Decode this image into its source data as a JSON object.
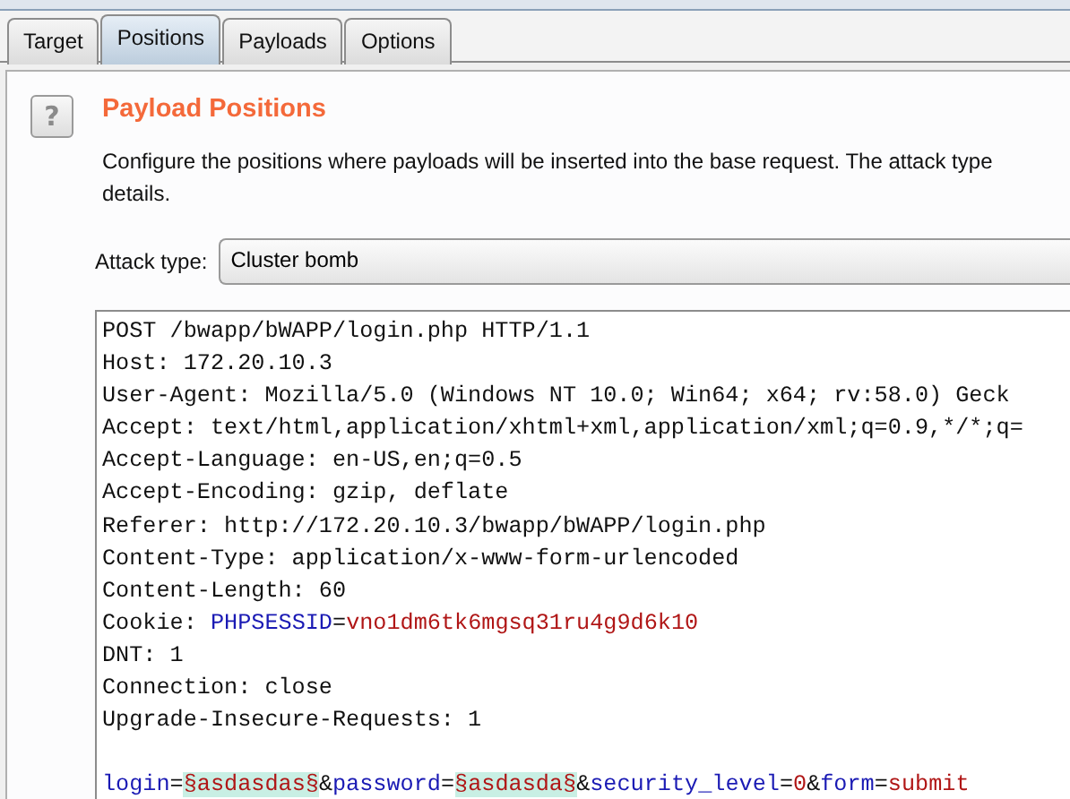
{
  "tabs": [
    {
      "label": "Target",
      "selected": false
    },
    {
      "label": "Positions",
      "selected": true
    },
    {
      "label": "Payloads",
      "selected": false
    },
    {
      "label": "Options",
      "selected": false
    }
  ],
  "help_button": {
    "label": "?"
  },
  "section": {
    "title": "Payload Positions",
    "description": [
      "Configure the positions where payloads will be inserted into the base request. The attack type",
      "details."
    ]
  },
  "attack_type": {
    "label": "Attack type:",
    "value": "Cluster bomb"
  },
  "request_editor": {
    "lines": [
      {
        "kind": "text",
        "segments": [
          {
            "kind": "plain",
            "text": "POST /bwapp/bWAPP/login.php HTTP/1.1"
          }
        ]
      },
      {
        "kind": "text",
        "segments": [
          {
            "kind": "plain",
            "text": "Host: 172.20.10.3"
          }
        ]
      },
      {
        "kind": "text",
        "segments": [
          {
            "kind": "plain",
            "text": "User-Agent: Mozilla/5.0 (Windows NT 10.0; Win64; x64; rv:58.0) Geck"
          }
        ]
      },
      {
        "kind": "text",
        "segments": [
          {
            "kind": "plain",
            "text": "Accept: text/html,application/xhtml+xml,application/xml;q=0.9,*/*;q="
          }
        ]
      },
      {
        "kind": "text",
        "segments": [
          {
            "kind": "plain",
            "text": "Accept-Language: en-US,en;q=0.5"
          }
        ]
      },
      {
        "kind": "text",
        "segments": [
          {
            "kind": "plain",
            "text": "Accept-Encoding: gzip, deflate"
          }
        ]
      },
      {
        "kind": "text",
        "segments": [
          {
            "kind": "plain",
            "text": "Referer: http://172.20.10.3/bwapp/bWAPP/login.php"
          }
        ]
      },
      {
        "kind": "text",
        "segments": [
          {
            "kind": "plain",
            "text": "Content-Type: application/x-www-form-urlencoded"
          }
        ]
      },
      {
        "kind": "text",
        "segments": [
          {
            "kind": "plain",
            "text": "Content-Length: 60"
          }
        ]
      },
      {
        "kind": "text",
        "segments": [
          {
            "kind": "plain",
            "text": "Cookie: "
          },
          {
            "kind": "name",
            "text": "PHPSESSID"
          },
          {
            "kind": "plain",
            "text": "="
          },
          {
            "kind": "value",
            "text": "vno1dm6tk6mgsq31ru4g9d6k10"
          }
        ]
      },
      {
        "kind": "text",
        "segments": [
          {
            "kind": "plain",
            "text": "DNT: 1"
          }
        ]
      },
      {
        "kind": "text",
        "segments": [
          {
            "kind": "plain",
            "text": "Connection: close"
          }
        ]
      },
      {
        "kind": "text",
        "segments": [
          {
            "kind": "plain",
            "text": "Upgrade-Insecure-Requests: 1"
          }
        ]
      },
      {
        "kind": "blank"
      },
      {
        "kind": "text",
        "segments": [
          {
            "kind": "name",
            "text": "login"
          },
          {
            "kind": "plain",
            "text": "="
          },
          {
            "kind": "marker",
            "text": "§asdasdas§"
          },
          {
            "kind": "plain",
            "text": "&"
          },
          {
            "kind": "name",
            "text": "password"
          },
          {
            "kind": "plain",
            "text": "="
          },
          {
            "kind": "marker",
            "text": "§asdasda§"
          },
          {
            "kind": "plain",
            "text": "&"
          },
          {
            "kind": "name",
            "text": "security_level"
          },
          {
            "kind": "plain",
            "text": "="
          },
          {
            "kind": "value",
            "text": "0"
          },
          {
            "kind": "plain",
            "text": "&"
          },
          {
            "kind": "name",
            "text": "form"
          },
          {
            "kind": "plain",
            "text": "="
          },
          {
            "kind": "value",
            "text": "submit"
          }
        ]
      }
    ]
  }
}
